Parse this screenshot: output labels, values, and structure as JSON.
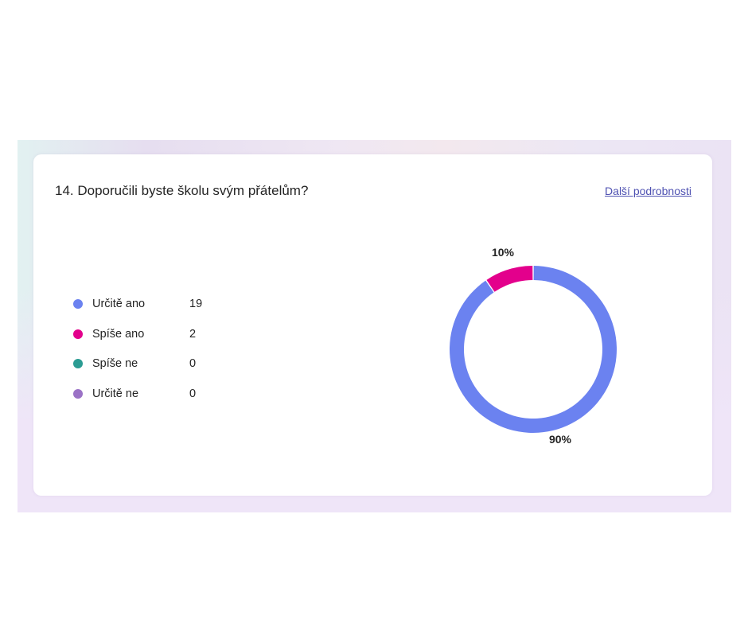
{
  "question": {
    "title": "14. Doporučili byste školu svým přátelům?",
    "details_link": "Další podrobnosti"
  },
  "chart_data": {
    "type": "pie",
    "style": "donut",
    "categories": [
      "Určitě ano",
      "Spíše ano",
      "Spíše ne",
      "Určitě ne"
    ],
    "values": [
      19,
      2,
      0,
      0
    ],
    "percent_labels": [
      "90%",
      "10%"
    ],
    "colors": [
      "#6b82f0",
      "#e3008c",
      "#2b9c93",
      "#9b72c6"
    ],
    "legend_position": "left"
  }
}
